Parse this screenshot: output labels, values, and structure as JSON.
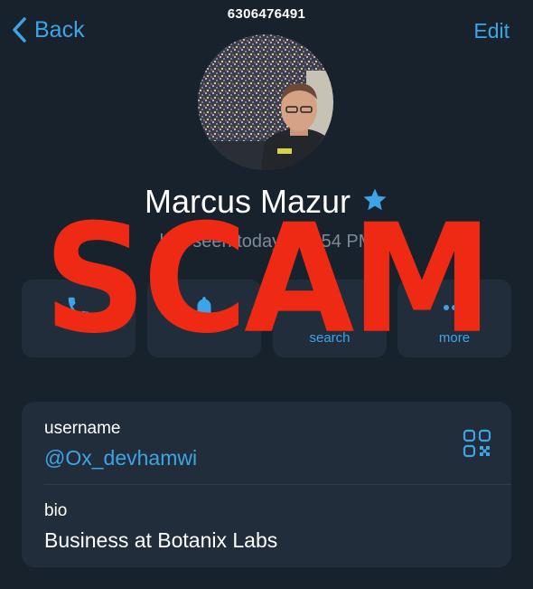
{
  "header": {
    "back_label": "Back",
    "title": "6306476491",
    "edit_label": "Edit"
  },
  "profile": {
    "name": "Marcus Mazur",
    "status": "last seen today at 5:54 PM"
  },
  "actions": [
    {
      "icon": "phone-icon",
      "label": ""
    },
    {
      "icon": "bell-icon",
      "label": ""
    },
    {
      "icon": "search-icon",
      "label": "search"
    },
    {
      "icon": "more-icon",
      "label": "more"
    }
  ],
  "info": {
    "username_label": "username",
    "username_value": "@Ox_devhamwi",
    "bio_label": "bio",
    "bio_value": "Business at Botanix Labs"
  },
  "overlay": {
    "stamp_text": "SCAM"
  },
  "colors": {
    "background": "#18222c",
    "card": "#212d3a",
    "accent": "#3fa4e6",
    "muted": "#7e8a97",
    "stamp": "#ef2a14"
  }
}
